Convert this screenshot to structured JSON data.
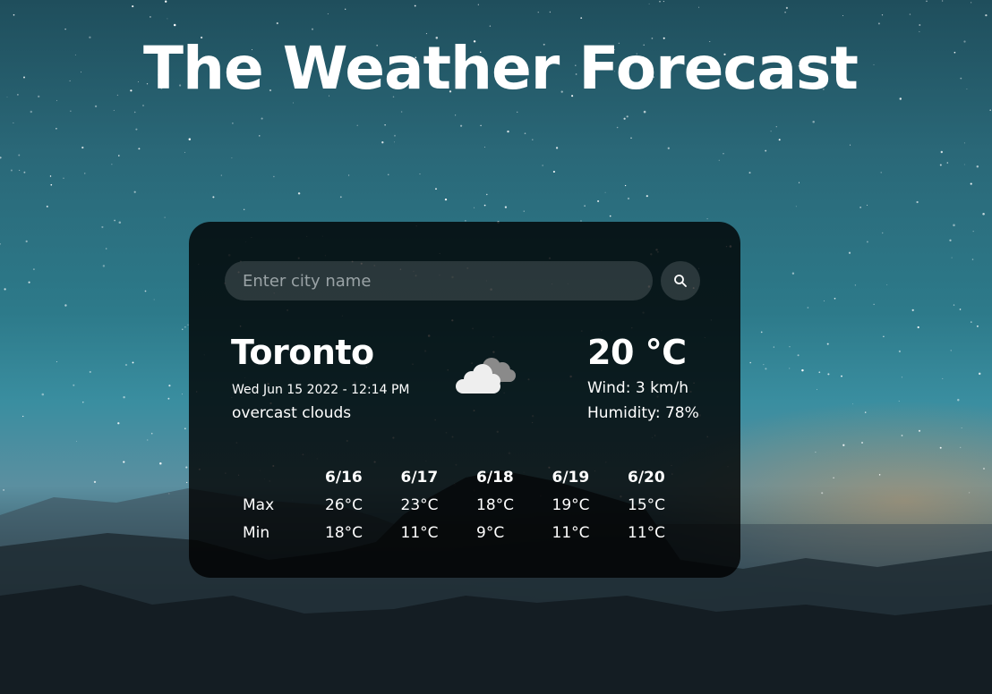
{
  "app": {
    "title": "The Weather Forecast"
  },
  "search": {
    "placeholder": "Enter city name",
    "value": "",
    "button_icon": "search-icon"
  },
  "current": {
    "city": "Toronto",
    "datetime": "Wed Jun 15 2022 - 12:14 PM",
    "description": "overcast clouds",
    "icon": "overcast-clouds-icon",
    "temperature": "20 °C",
    "wind": "Wind: 3 km/h",
    "humidity": "Humidity: 78%"
  },
  "forecast": {
    "row_labels": {
      "max": "Max",
      "min": "Min"
    },
    "days": [
      {
        "date": "6/16",
        "max": "26°C",
        "min": "18°C"
      },
      {
        "date": "6/17",
        "max": "23°C",
        "min": "11°C"
      },
      {
        "date": "6/18",
        "max": "18°C",
        "min": "9°C"
      },
      {
        "date": "6/19",
        "max": "19°C",
        "min": "11°C"
      },
      {
        "date": "6/20",
        "max": "15°C",
        "min": "11°C"
      }
    ]
  },
  "colors": {
    "card_background": "#000000",
    "text": "#ffffff",
    "sky": "#2a6878"
  }
}
